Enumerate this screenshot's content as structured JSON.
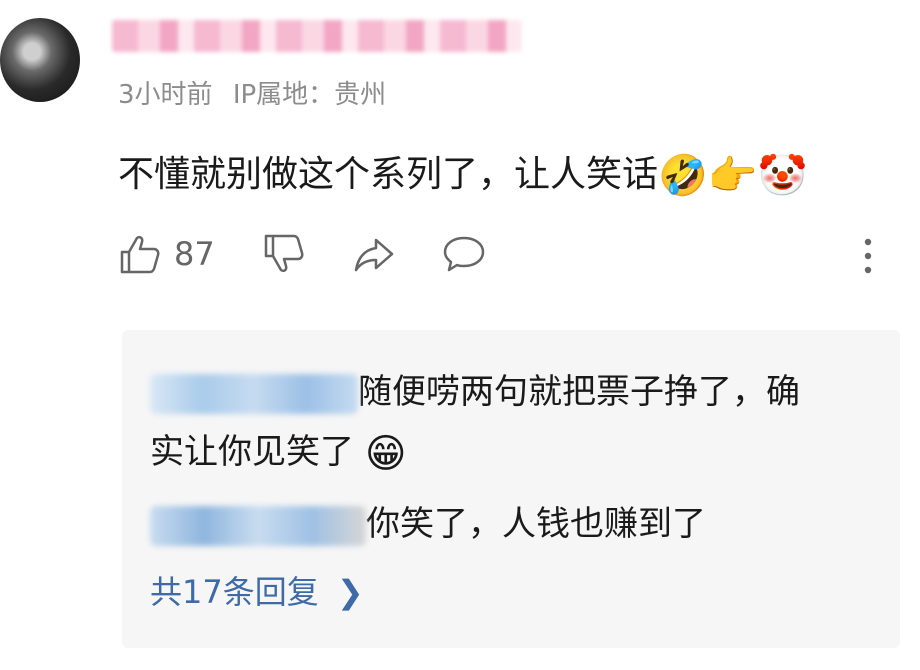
{
  "comment": {
    "username_text": "",
    "time": "3小时前",
    "ip_location": "IP属地：贵州",
    "text": "不懂就别做这个系列了，让人笑话",
    "emojis": [
      "🤣",
      "👉",
      "🤡"
    ],
    "like_count": "87"
  },
  "replies": [
    {
      "text_line1": "随便唠两句就把票子挣了，确",
      "text_line2": "实让你见笑了",
      "emoji": "😁"
    },
    {
      "text": "你笑了，人钱也赚到了"
    }
  ],
  "view_all_label": "共17条回复",
  "view_all_chevron": "❯",
  "icons": [
    "thumbs-up-icon",
    "thumbs-down-icon",
    "share-icon",
    "comment-icon",
    "more-icon"
  ]
}
